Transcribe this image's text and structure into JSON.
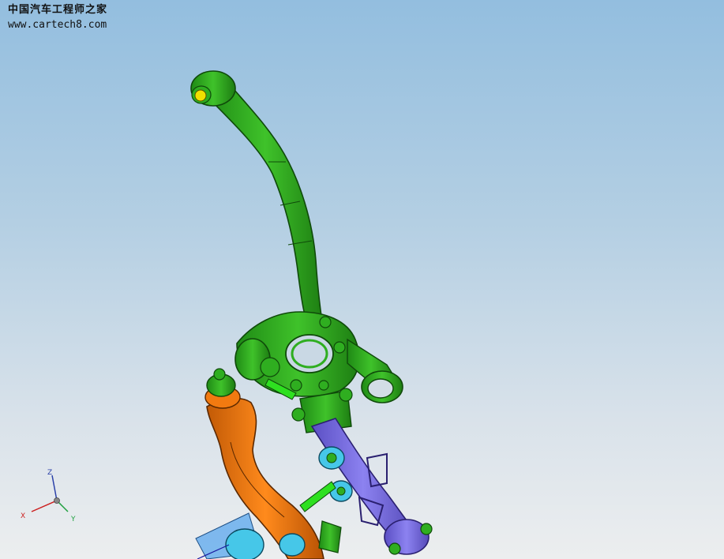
{
  "watermark": {
    "title": "中国汽车工程师之家",
    "url": "www.cartech8.com"
  },
  "triad": {
    "z_label": "Z",
    "x_label": "X",
    "y_label": "Y"
  },
  "colors": {
    "knuckle": "#2fae20",
    "knuckle_dark": "#0f4a0a",
    "bushing": "#f0e000",
    "lower_arm": "#f27a10",
    "tie_rod": "#7a6ee0",
    "joint": "#46c7e8",
    "plate": "#5aa7ee",
    "link_green": "#2ee020"
  },
  "icons": {
    "triad": "xyz-axis-triad-icon"
  }
}
